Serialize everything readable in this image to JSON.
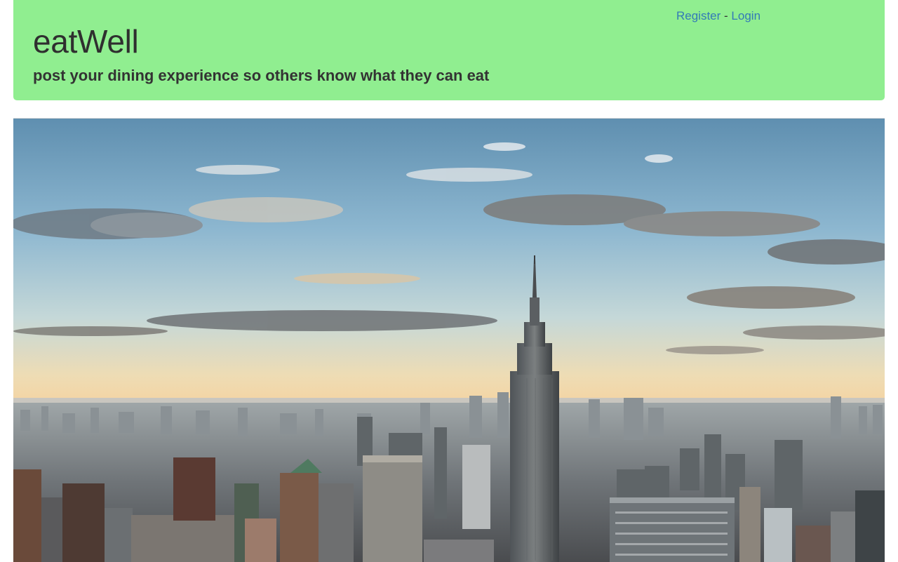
{
  "header": {
    "brand": "eatWell",
    "tagline": "post your dining experience so others know what they can eat",
    "background_color": "#90ee90"
  },
  "auth": {
    "register_label": "Register",
    "separator": " - ",
    "login_label": "Login",
    "link_color": "#337ab7"
  },
  "hero": {
    "image_subject": "city-skyline-photo"
  }
}
